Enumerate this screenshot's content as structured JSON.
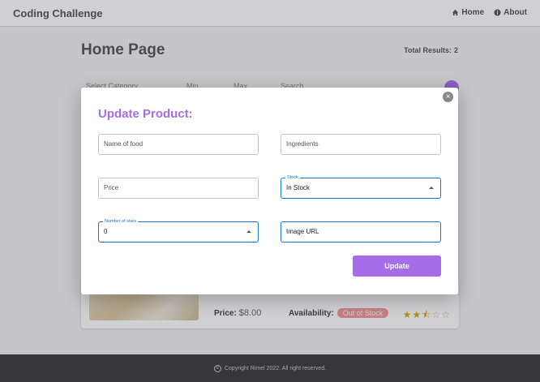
{
  "navbar": {
    "brand": "Coding Challenge",
    "links": [
      {
        "label": "Home",
        "icon": "home-icon"
      },
      {
        "label": "About",
        "icon": "info-icon"
      }
    ]
  },
  "page": {
    "title": "Home Page",
    "total_label": "Total Results:",
    "total_value": "2"
  },
  "filters": {
    "category": "Select Category",
    "min": "Min",
    "max": "Max",
    "search": "Search"
  },
  "card": {
    "price_label": "Price:",
    "price_value": "$8.00",
    "availability_label": "Availability:",
    "availability_value": "Out of Stock",
    "rating_filled": 2.5,
    "rating_max": 5
  },
  "footer": {
    "text": "Copyright Rimel 2022. All right reserved."
  },
  "modal": {
    "title": "Update Product:",
    "fields": {
      "name_placeholder": "Name of food",
      "ingredients_placeholder": "Ingredients",
      "price_placeholder": "Price",
      "stock_label": "Stock",
      "stock_value": "In Stock",
      "stars_label": "Number of stars",
      "stars_value": "0",
      "image_url_value": "Image URL"
    },
    "update_label": "Update",
    "close_icon": "close-icon"
  },
  "colors": {
    "accent": "#a56ee8",
    "focus": "#1976d2",
    "out_of_stock": "#f19a9a",
    "footer_bg": "#3a3a3e"
  }
}
